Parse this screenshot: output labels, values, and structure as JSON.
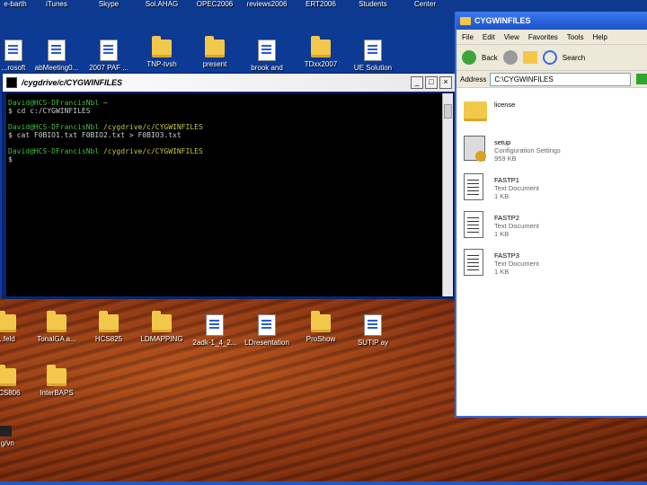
{
  "desktop": {
    "top_row": [
      "e-barth",
      "iTunes",
      "Skype",
      "Sol.AHAG",
      "OPEC2006",
      "reviews2006",
      "ERT2006",
      "Students",
      "Center"
    ],
    "second_row": [
      "...rosoft",
      "abMeeting0...",
      "2007 PAF ...",
      "TNP-tvsh",
      "present",
      "brook and",
      "TDxx2007",
      "UE Solution"
    ],
    "mid_row": [
      "...feld",
      "TonalGA a...",
      "HCS825",
      "LDMAPPING",
      "2adk-1_4_2...",
      "LDresentation",
      "ProShow",
      "SUTIP ay"
    ],
    "low_row": [
      "...CS806",
      "InterBAPS"
    ],
    "bottom_left": "...g/vn"
  },
  "terminal": {
    "title": "/cygdrive/c/CYGWINFILES",
    "buttons": {
      "min": "_",
      "max": "□",
      "close": "×"
    },
    "lines": [
      {
        "prompt": "David@HCS-DFrancisNbl",
        "path": "~"
      },
      {
        "cmd": "$ cd c:/CYGWINFILES"
      },
      {
        "prompt": "David@HCS-DFrancisNbl",
        "path": "/cygdrive/c/CYGWINFILES"
      },
      {
        "cmd": "$ cat F0BIO1.txt F0BIO2.txt > F0BIO3.txt"
      },
      {
        "prompt": "David@HCS-DFrancisNbl",
        "path": "/cygdrive/c/CYGWINFILES"
      },
      {
        "cmd": "$"
      }
    ]
  },
  "explorer": {
    "title": "CYGWINFILES",
    "menu": [
      "File",
      "Edit",
      "View",
      "Favorites",
      "Tools",
      "Help"
    ],
    "toolbar": {
      "back": "Back",
      "search": "Search"
    },
    "address_label": "Address",
    "address_value": "C:\\CYGWINFILES",
    "items": [
      {
        "name": "license",
        "type": "",
        "size": "",
        "icon": "folder-icon"
      },
      {
        "name": "setup",
        "type": "Configuration Settings",
        "size": "959 KB",
        "icon": "setup-icon"
      },
      {
        "name": "FASTP1",
        "type": "Text Document",
        "size": "1 KB",
        "icon": "text-file-icon"
      },
      {
        "name": "FASTP2",
        "type": "Text Document",
        "size": "1 KB",
        "icon": "text-file-icon"
      },
      {
        "name": "FASTP3",
        "type": "Text Document",
        "size": "1 KB",
        "icon": "text-file-icon"
      }
    ]
  }
}
